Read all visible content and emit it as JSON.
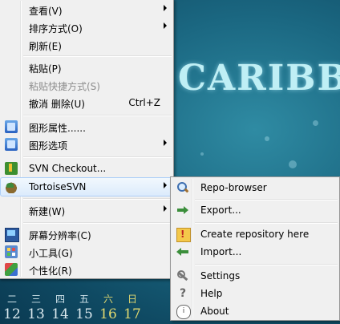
{
  "desktop": {
    "brand_text": "CARIBB",
    "calendar": {
      "weekdays": [
        "二",
        "三",
        "四",
        "五",
        "六",
        "日"
      ],
      "dates": [
        "12",
        "13",
        "14",
        "15",
        "16",
        "17"
      ]
    }
  },
  "context_menu": {
    "view": "查看(V)",
    "sort_by": "排序方式(O)",
    "refresh": "刷新(E)",
    "paste": "粘贴(P)",
    "paste_shortcut": "粘贴快捷方式(S)",
    "undo_delete": "撤消 删除(U)",
    "undo_shortcut": "Ctrl+Z",
    "graphics_properties": "图形属性......",
    "graphics_options": "图形选项",
    "svn_checkout": "SVN Checkout...",
    "tortoise_svn": "TortoiseSVN",
    "new": "新建(W)",
    "screen_resolution": "屏幕分辨率(C)",
    "gadgets": "小工具(G)",
    "personalize": "个性化(R)"
  },
  "tortoise_submenu": {
    "repo_browser": "Repo-browser",
    "export": "Export...",
    "create_repository": "Create repository here",
    "import": "Import...",
    "settings": "Settings",
    "help": "Help",
    "about": "About"
  }
}
